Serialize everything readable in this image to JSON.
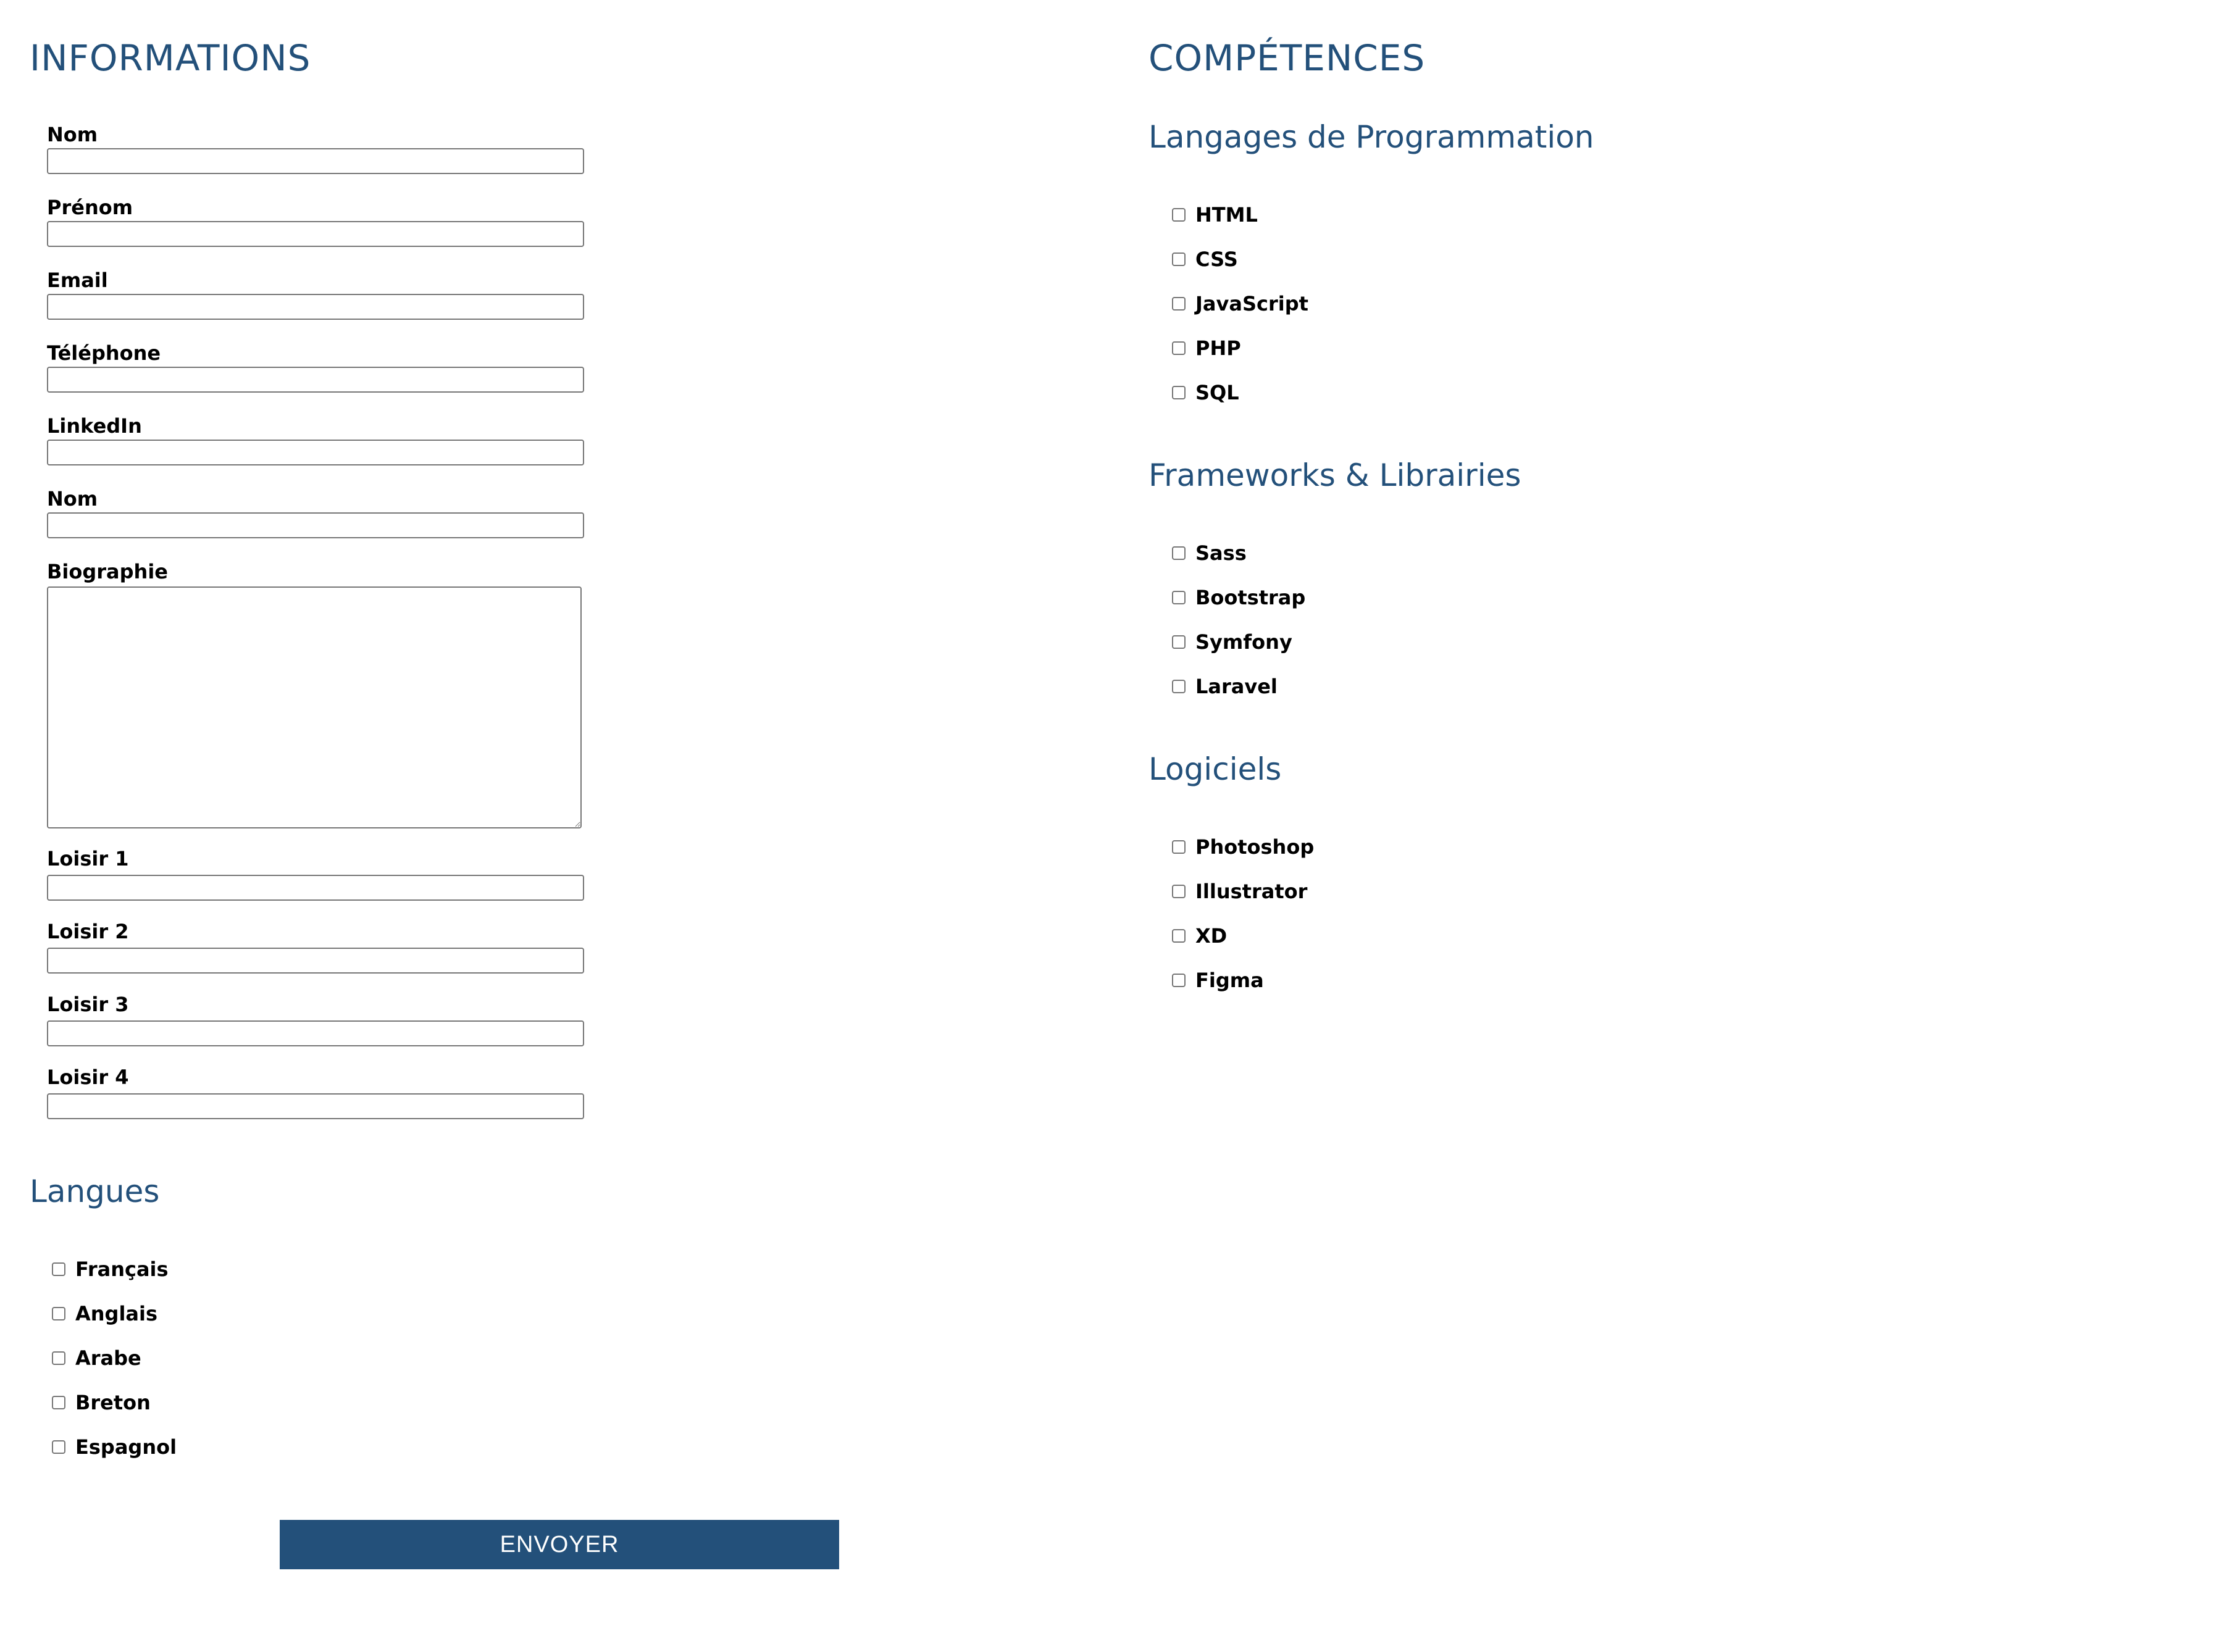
{
  "informations": {
    "title": "INFORMATIONS",
    "fields": [
      {
        "label": "Nom",
        "value": ""
      },
      {
        "label": "Prénom",
        "value": ""
      },
      {
        "label": "Email",
        "value": ""
      },
      {
        "label": "Téléphone",
        "value": ""
      },
      {
        "label": "LinkedIn",
        "value": ""
      },
      {
        "label": "Nom",
        "value": ""
      }
    ],
    "bio_label": "Biographie",
    "bio_value": "",
    "hobbies": [
      {
        "label": "Loisir 1",
        "value": ""
      },
      {
        "label": "Loisir 2",
        "value": ""
      },
      {
        "label": "Loisir 3",
        "value": ""
      },
      {
        "label": "Loisir 4",
        "value": ""
      }
    ]
  },
  "langues": {
    "title": "Langues",
    "items": [
      "Français",
      "Anglais",
      "Arabe",
      "Breton",
      "Espagnol"
    ]
  },
  "competences": {
    "title": "COMPÉTENCES",
    "groups": [
      {
        "title": "Langages de Programmation",
        "items": [
          "HTML",
          "CSS",
          "JavaScript",
          "PHP",
          "SQL"
        ]
      },
      {
        "title": "Frameworks & Librairies",
        "items": [
          "Sass",
          "Bootstrap",
          "Symfony",
          "Laravel"
        ]
      },
      {
        "title": "Logiciels",
        "items": [
          "Photoshop",
          "Illustrator",
          "XD",
          "Figma"
        ]
      }
    ]
  },
  "submit": {
    "label": "ENVOYER"
  },
  "colors": {
    "accent": "#23507a",
    "border": "#767676"
  }
}
